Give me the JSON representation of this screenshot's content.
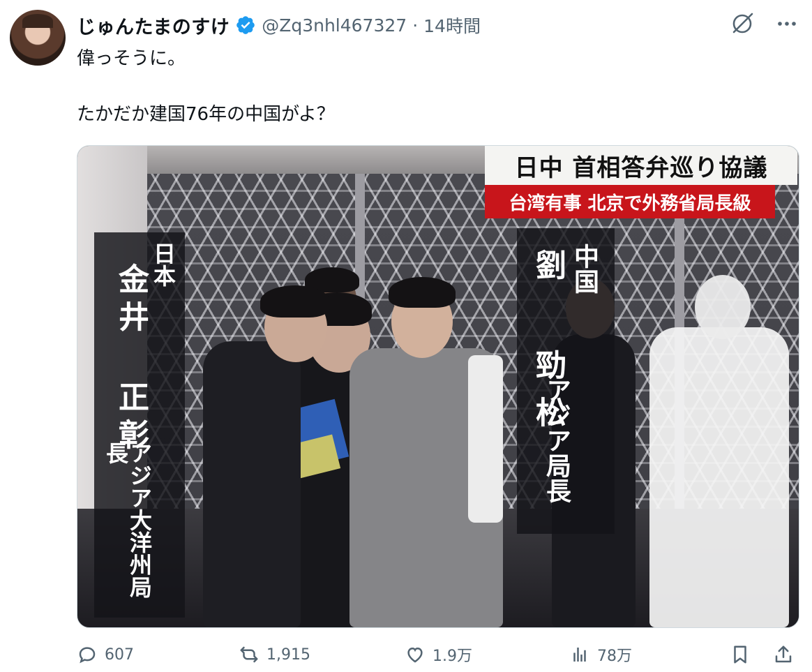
{
  "post": {
    "display_name": "じゅんたまのすけ",
    "handle": "@Zq3nhl467327",
    "separator": "·",
    "time": "14時間",
    "text_line1": "偉っそうに。",
    "text_line2": "たかだか建国76年の中国がよ？"
  },
  "media": {
    "headline": "日中 首相答弁巡り協議",
    "subheadline": "台湾有事 北京で外務省局長級",
    "left_country": "日本",
    "left_name": "金井 正彰",
    "left_title": "アジア大洋州局長",
    "right_country": "中国",
    "right_name": "劉 勁松",
    "right_title": "アジア局長"
  },
  "actions": {
    "replies": "607",
    "reposts": "1,915",
    "likes": "1.9万",
    "views": "78万"
  },
  "colors": {
    "verified": "#1d9bf0",
    "secondary_text": "#536471",
    "caption_red": "#c8151b"
  }
}
